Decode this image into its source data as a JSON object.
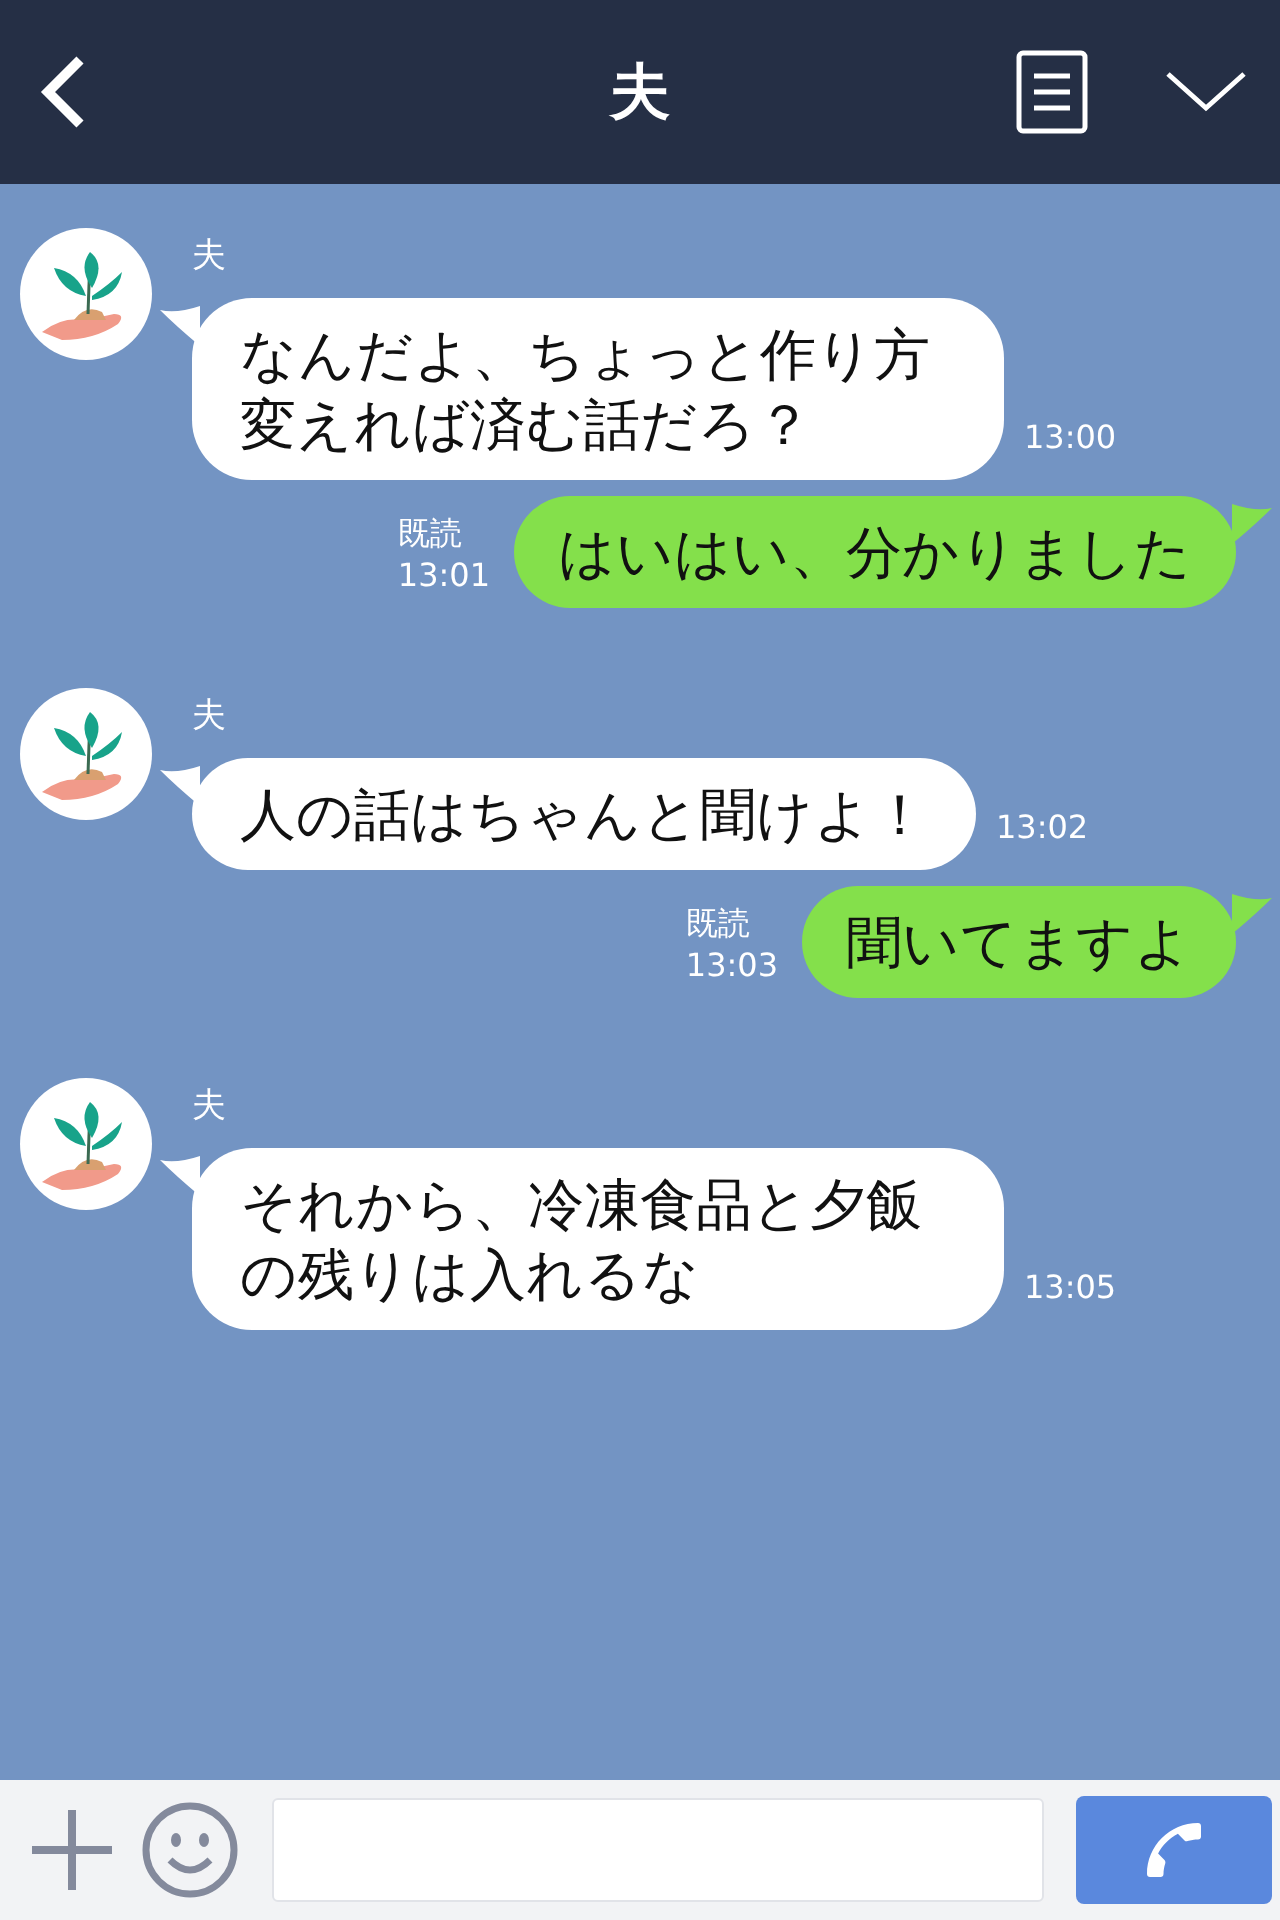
{
  "header": {
    "title": "夫"
  },
  "messages": [
    {
      "kind": "incoming",
      "sender": "夫",
      "text": "なんだよ、ちょっと作り方変えれば済む話だろ？",
      "time": "13:00"
    },
    {
      "kind": "outgoing",
      "read": "既読",
      "text": "はいはい、分かりました",
      "time": "13:01"
    },
    {
      "kind": "incoming",
      "sender": "夫",
      "text": "人の話はちゃんと聞けよ！",
      "time": "13:02"
    },
    {
      "kind": "outgoing",
      "read": "既読",
      "text": "聞いてますよ",
      "time": "13:03"
    },
    {
      "kind": "incoming",
      "sender": "夫",
      "text": "それから、冷凍食品と夕飯の残りは入れるな",
      "time": "13:05"
    }
  ]
}
